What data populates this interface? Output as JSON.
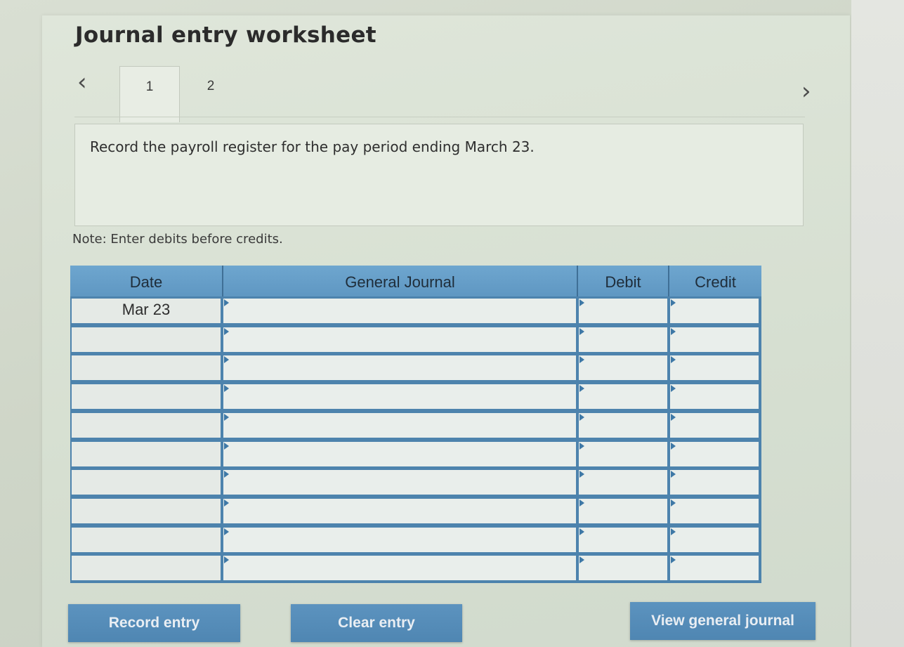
{
  "worksheet": {
    "title": "Journal entry worksheet"
  },
  "navigation": {
    "prev_icon": "chevron-left-icon",
    "prev_glyph": "‹",
    "next_icon": "chevron-right-icon",
    "next_glyph": "›",
    "tabs": [
      {
        "label": "1",
        "active": true
      },
      {
        "label": "2",
        "active": false
      }
    ]
  },
  "instruction": "Record the payroll register for the pay period ending March 23.",
  "note": "Note: Enter debits before credits.",
  "journal": {
    "headers": {
      "date": "Date",
      "general_journal": "General Journal",
      "debit": "Debit",
      "credit": "Credit"
    },
    "rows": [
      {
        "date": "Mar 23",
        "account": "",
        "debit": "",
        "credit": ""
      },
      {
        "date": "",
        "account": "",
        "debit": "",
        "credit": ""
      },
      {
        "date": "",
        "account": "",
        "debit": "",
        "credit": ""
      },
      {
        "date": "",
        "account": "",
        "debit": "",
        "credit": ""
      },
      {
        "date": "",
        "account": "",
        "debit": "",
        "credit": ""
      },
      {
        "date": "",
        "account": "",
        "debit": "",
        "credit": ""
      },
      {
        "date": "",
        "account": "",
        "debit": "",
        "credit": ""
      },
      {
        "date": "",
        "account": "",
        "debit": "",
        "credit": ""
      },
      {
        "date": "",
        "account": "",
        "debit": "",
        "credit": ""
      },
      {
        "date": "",
        "account": "",
        "debit": "",
        "credit": ""
      }
    ]
  },
  "buttons": {
    "record_entry": "Record entry",
    "clear_entry": "Clear entry",
    "view_general_journal": "View general journal"
  },
  "colors": {
    "header_blue": "#5f97c2",
    "button_blue": "#4f86b2",
    "panel_green": "#d6dfd1"
  }
}
